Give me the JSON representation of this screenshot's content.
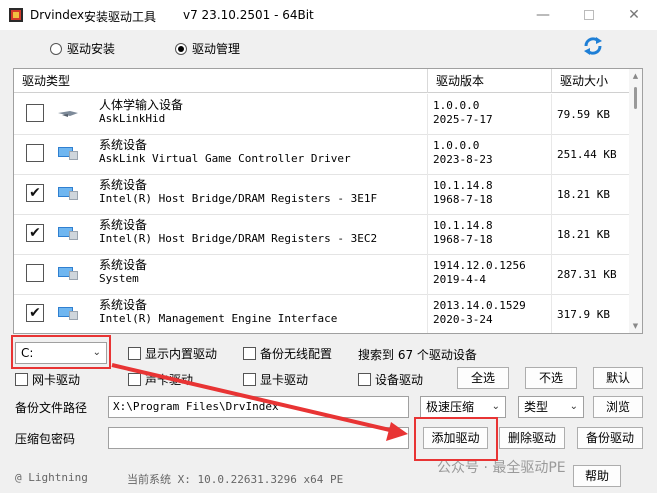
{
  "titlebar": {
    "app_name": "Drvindex",
    "tool_name": "安装驱动工具",
    "version": "v7  23.10.2501  - 64Bit"
  },
  "mode": {
    "install_label": "驱动安装",
    "manage_label": "驱动管理",
    "selected": "驱动管理"
  },
  "list": {
    "headers": [
      "驱动类型",
      "驱动版本",
      "驱动大小"
    ],
    "rows": [
      {
        "checked": false,
        "category": "人体学输入设备",
        "name": "AskLinkHid",
        "version": "1.0.0.0",
        "date": "2025-7-17",
        "size": "79.59 KB",
        "icon": "hid-icon"
      },
      {
        "checked": false,
        "category": "系统设备",
        "name": "AskLink Virtual Game Controller Driver",
        "version": "1.0.0.0",
        "date": "2023-8-23",
        "size": "251.44 KB",
        "icon": "system-device-icon"
      },
      {
        "checked": true,
        "category": "系统设备",
        "name": "Intel(R) Host Bridge/DRAM Registers - 3E1F",
        "version": "10.1.14.8",
        "date": "1968-7-18",
        "size": "18.21 KB",
        "icon": "system-device-icon"
      },
      {
        "checked": true,
        "category": "系统设备",
        "name": "Intel(R) Host Bridge/DRAM Registers - 3EC2",
        "version": "10.1.14.8",
        "date": "1968-7-18",
        "size": "18.21 KB",
        "icon": "system-device-icon"
      },
      {
        "checked": false,
        "category": "系统设备",
        "name": "System",
        "version": "1914.12.0.1256",
        "date": "2019-4-4",
        "size": "287.31 KB",
        "icon": "system-device-icon"
      },
      {
        "checked": true,
        "category": "系统设备",
        "name": "Intel(R) Management Engine Interface",
        "version": "2013.14.0.1529",
        "date": "2020-3-24",
        "size": "317.9 KB",
        "icon": "system-device-icon"
      }
    ]
  },
  "filters": {
    "drive": "C:",
    "show_builtin": "显示内置驱动",
    "backup_wireless": "备份无线配置",
    "found_text": "搜索到 67 个驱动设备",
    "network": "网卡驱动",
    "sound": "声卡驱动",
    "graphics": "显卡驱动",
    "device": "设备驱动",
    "select_all": "全选",
    "deselect": "不选",
    "default": "默认"
  },
  "backup": {
    "path_label": "备份文件路径",
    "path_value": "X:\\Program Files\\DrvIndex",
    "compression": "极速压缩",
    "type": "类型",
    "browse": "浏览"
  },
  "password": {
    "label": "压缩包密码",
    "value": ""
  },
  "actions": {
    "add": "添加驱动",
    "delete": "删除驱动",
    "backup": "备份驱动",
    "help": "帮助"
  },
  "status": {
    "author": "@ Lightning",
    "system": "当前系统 X: 10.0.22631.3296 x64  PE"
  },
  "watermark": "公众号 · 最全驱动PE",
  "colors": {
    "highlight": "#e83434",
    "refresh": "#1e7fd6"
  }
}
